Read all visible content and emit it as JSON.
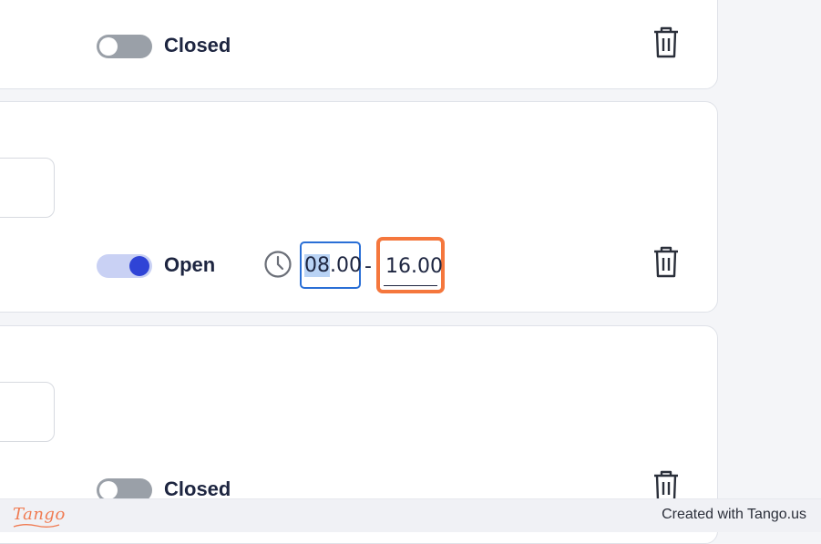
{
  "rows": [
    {
      "status_label": "Closed",
      "is_open": false
    },
    {
      "status_label": "Open",
      "is_open": true,
      "start_time_selected": "08",
      "start_time_rest": ".00",
      "separator": "-",
      "end_time": "16.00"
    },
    {
      "status_label": "Closed",
      "is_open": false
    }
  ],
  "footer": {
    "brand": "Tango",
    "credit": "Created with Tango.us"
  },
  "colors": {
    "accent": "#2f44d6",
    "highlight_orange": "#f5773d",
    "focus_blue": "#2a6fd6"
  },
  "icons": {
    "delete": "trash-icon",
    "time": "clock-icon"
  }
}
